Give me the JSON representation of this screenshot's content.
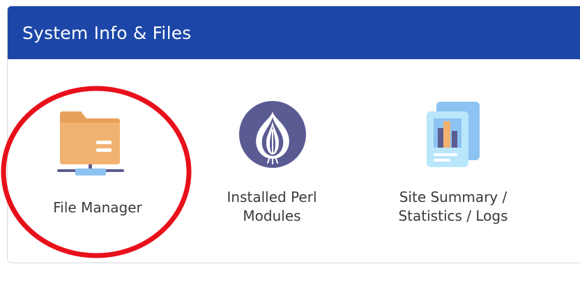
{
  "panel": {
    "title": "System Info & Files",
    "header_color": "#1c47a8"
  },
  "tools": [
    {
      "icon": "folder-network-icon",
      "label_line1": "File Manager",
      "label_line2": ""
    },
    {
      "icon": "perl-onion-icon",
      "label_line1": "Installed Perl",
      "label_line2": "Modules"
    },
    {
      "icon": "statistics-document-icon",
      "label_line1": "Site Summary /",
      "label_line2": "Statistics / Logs"
    }
  ],
  "annotation": {
    "highlight_color": "#e8101a"
  }
}
